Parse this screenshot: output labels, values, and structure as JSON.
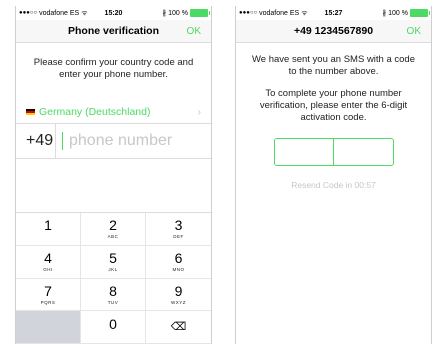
{
  "status_left": {
    "carrier": "vodafone ES",
    "time": "15:20",
    "battery": "100 %"
  },
  "status_right": {
    "carrier": "vodafone ES",
    "time": "15:27",
    "battery": "100 %"
  },
  "left_screen": {
    "title": "Phone verification",
    "ok_label": "OK",
    "instruction": "Please confirm your country code and enter your phone number.",
    "country_name": "Germany (Deutschland)",
    "country_code": "+49",
    "phone_placeholder": "phone number",
    "keys": [
      {
        "digit": "1",
        "letters": ""
      },
      {
        "digit": "2",
        "letters": "ABC"
      },
      {
        "digit": "3",
        "letters": "DEF"
      },
      {
        "digit": "4",
        "letters": "GHI"
      },
      {
        "digit": "5",
        "letters": "JKL"
      },
      {
        "digit": "6",
        "letters": "MNO"
      },
      {
        "digit": "7",
        "letters": "PQRS"
      },
      {
        "digit": "8",
        "letters": "TUV"
      },
      {
        "digit": "9",
        "letters": "WXYZ"
      },
      {
        "digit": "",
        "letters": ""
      },
      {
        "digit": "0",
        "letters": ""
      },
      {
        "digit": "⌫",
        "letters": ""
      }
    ]
  },
  "right_screen": {
    "title": "+49 1234567890",
    "ok_label": "OK",
    "sms_message": "We have sent you an SMS with a code to the number above.",
    "instruction": "To complete your phone number verification, please enter the 6-digit activation code.",
    "resend_label": "Resend Code in 00:57"
  },
  "colors": {
    "accent": "#4cd964",
    "placeholder": "#c7c7cc",
    "keypad_blank": "#d1d5db"
  }
}
